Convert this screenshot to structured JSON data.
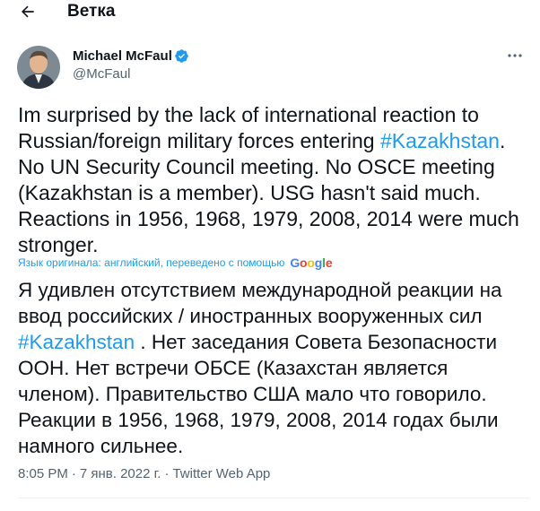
{
  "header": {
    "title": "Ветка"
  },
  "author": {
    "name": "Michael McFaul",
    "handle": "@McFaul"
  },
  "tweet": {
    "text_1": "Im surprised by the lack of international reaction to Russian/foreign military forces entering ",
    "hashtag_1": "#Kazakhstan",
    "text_2": ". No UN Security Council meeting. No OSCE meeting (Kazakhstan is a member). USG hasn't said much. Reactions in 1956, 1968, 1979, 2008, 2014 were much stronger."
  },
  "translation": {
    "note": "Язык оригинала: английский, переведено с помощью",
    "provider": "Google",
    "text_1": "Я удивлен отсутствием международной реакции на ввод российских / иностранных вооруженных сил ",
    "hashtag_1": "#Kazakhstan",
    "text_2": " . Нет заседания Совета Безопасности ООН. Нет встречи ОБСЕ (Казахстан является членом). Правительство США мало что говорило. Реакции в 1956, 1968, 1979, 2008, 2014 годах были намного сильнее."
  },
  "meta": {
    "time": "8:05 PM",
    "separator": "·",
    "date": "7 янв. 2022 г.",
    "source": "Twitter Web App"
  },
  "icons": {
    "back": "arrow-left-icon",
    "verified": "verified-badge-icon",
    "more": "more-horizontal-icon"
  },
  "colors": {
    "accent": "#1d9bf0",
    "secondary_text": "#536471",
    "text": "#0f1419"
  }
}
